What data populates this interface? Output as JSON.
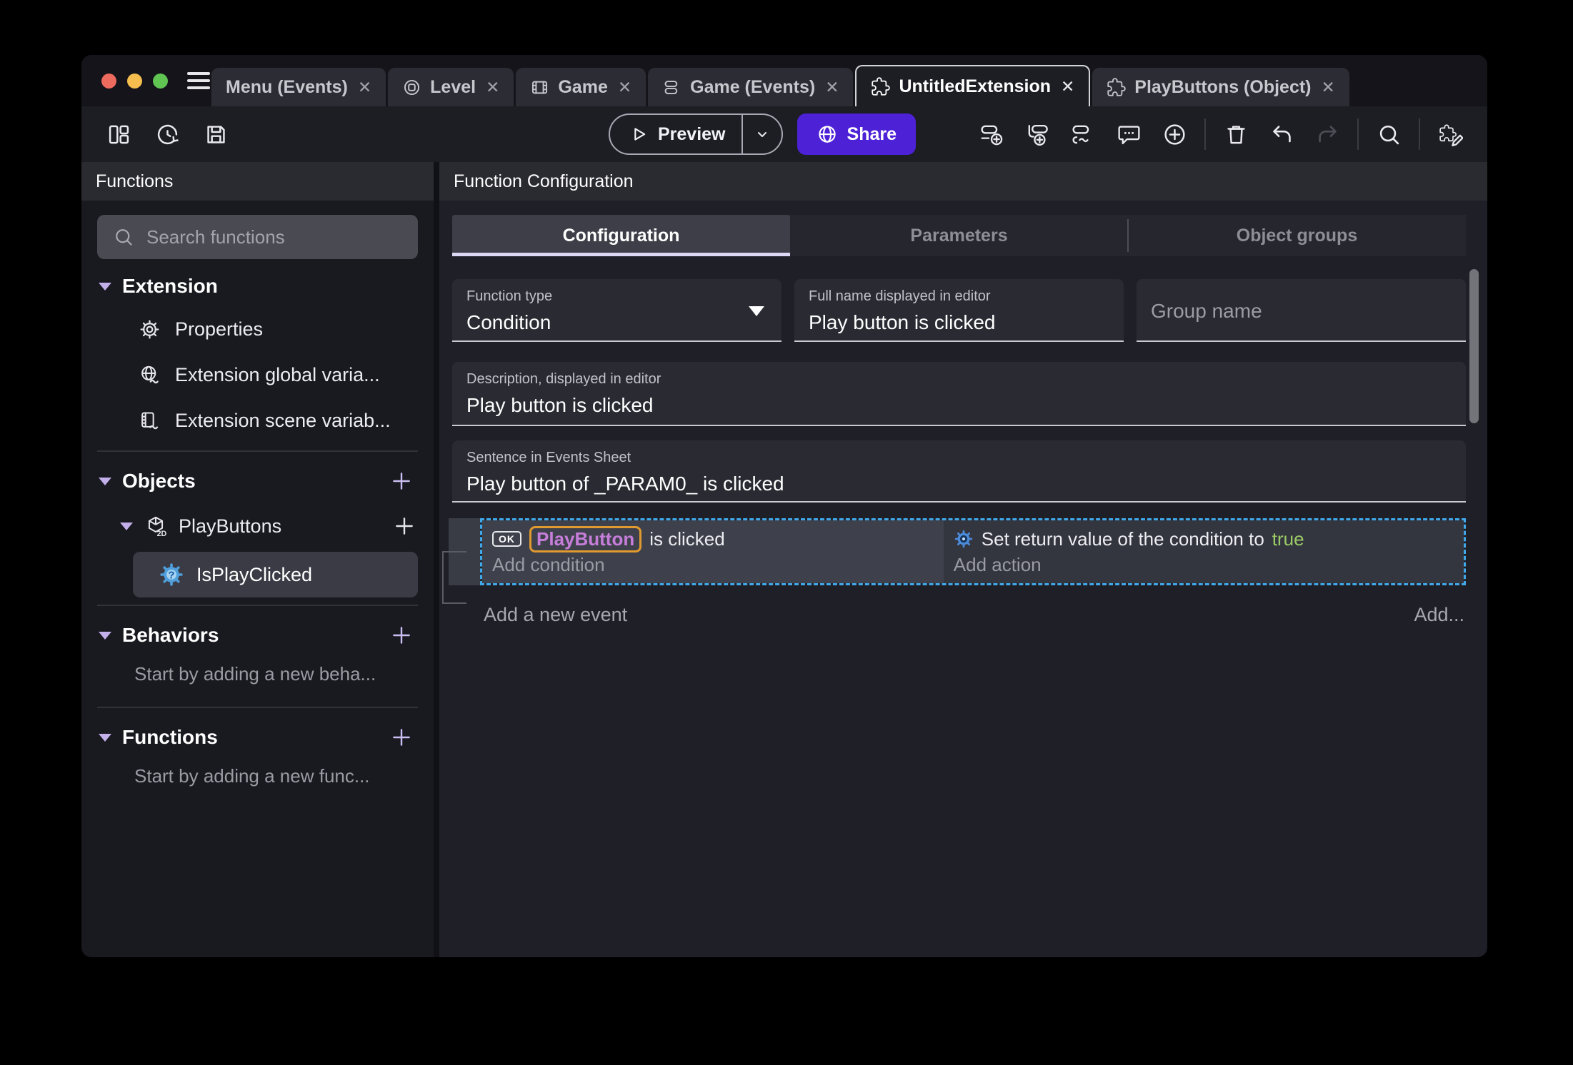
{
  "colors": {
    "accent_purple": "#4D21D6",
    "selection_blue": "#41A9E9",
    "object_chip_text": "#C77EDB",
    "object_chip_outline": "#E09A2F",
    "true_green": "#9CCC65",
    "traffic_red": "#ED6A5E",
    "traffic_yellow": "#F5BE4F",
    "traffic_green": "#61C554"
  },
  "titlebar": {
    "tabs": [
      {
        "label": "Menu (Events)",
        "icon": null,
        "close": "✕",
        "active": false
      },
      {
        "label": "Level",
        "icon": "level-icon",
        "close": "✕",
        "active": false
      },
      {
        "label": "Game",
        "icon": "game-icon",
        "close": "✕",
        "active": false
      },
      {
        "label": "Game (Events)",
        "icon": "events-icon",
        "close": "✕",
        "active": false
      },
      {
        "label": "UntitledExtension",
        "icon": "extension-icon",
        "close": "✕",
        "active": true
      },
      {
        "label": "PlayButtons (Object)",
        "icon": "extension-icon",
        "close": "✕",
        "active": false
      }
    ]
  },
  "toolbar": {
    "preview_label": "Preview",
    "share_label": "Share",
    "left_icons": [
      "layout-panels-icon",
      "history-icon",
      "save-icon"
    ],
    "right_icons": [
      "add-event-icon",
      "add-subevent-icon",
      "add-other-event-icon",
      "add-comment-icon",
      "circle-plus-icon",
      "trash-icon",
      "undo-icon",
      "redo-icon",
      "search-icon",
      "edit-extension-icon"
    ]
  },
  "sidebar": {
    "header": "Functions",
    "search_placeholder": "Search functions",
    "extension": {
      "label": "Extension",
      "items": [
        {
          "icon": "gear-icon",
          "label": "Properties"
        },
        {
          "icon": "globe-variable-icon",
          "label": "Extension global varia..."
        },
        {
          "icon": "scene-variable-icon",
          "label": "Extension scene variab..."
        }
      ]
    },
    "objects": {
      "label": "Objects",
      "group": {
        "icon": "cube-2d-icon",
        "label": "PlayButtons"
      },
      "selected_item": {
        "icon": "condition-function-icon",
        "label": "IsPlayClicked"
      }
    },
    "behaviors": {
      "label": "Behaviors",
      "empty": "Start by adding a new beha..."
    },
    "functions": {
      "label": "Functions",
      "empty": "Start by adding a new func..."
    }
  },
  "main": {
    "header": "Function Configuration",
    "tabs": [
      {
        "label": "Configuration",
        "active": true
      },
      {
        "label": "Parameters",
        "active": false
      },
      {
        "label": "Object groups",
        "active": false
      }
    ],
    "form": {
      "function_type": {
        "label": "Function type",
        "value": "Condition"
      },
      "full_name": {
        "label": "Full name displayed in editor",
        "value": "Play button is clicked"
      },
      "group_name": {
        "placeholder": "Group name"
      },
      "description": {
        "label": "Description, displayed in editor",
        "value": "Play button is clicked"
      },
      "sentence": {
        "label": "Sentence in Events Sheet",
        "value": "Play button of _PARAM0_ is clicked"
      }
    },
    "events_sheet": {
      "ok_badge": "OK",
      "condition_object": "PlayButton",
      "condition_text": "is clicked",
      "add_condition": "Add condition",
      "action_text": "Set return value of the condition to",
      "action_value": "true",
      "add_action": "Add action",
      "add_new_event": "Add a new event",
      "add_more": "Add..."
    }
  }
}
